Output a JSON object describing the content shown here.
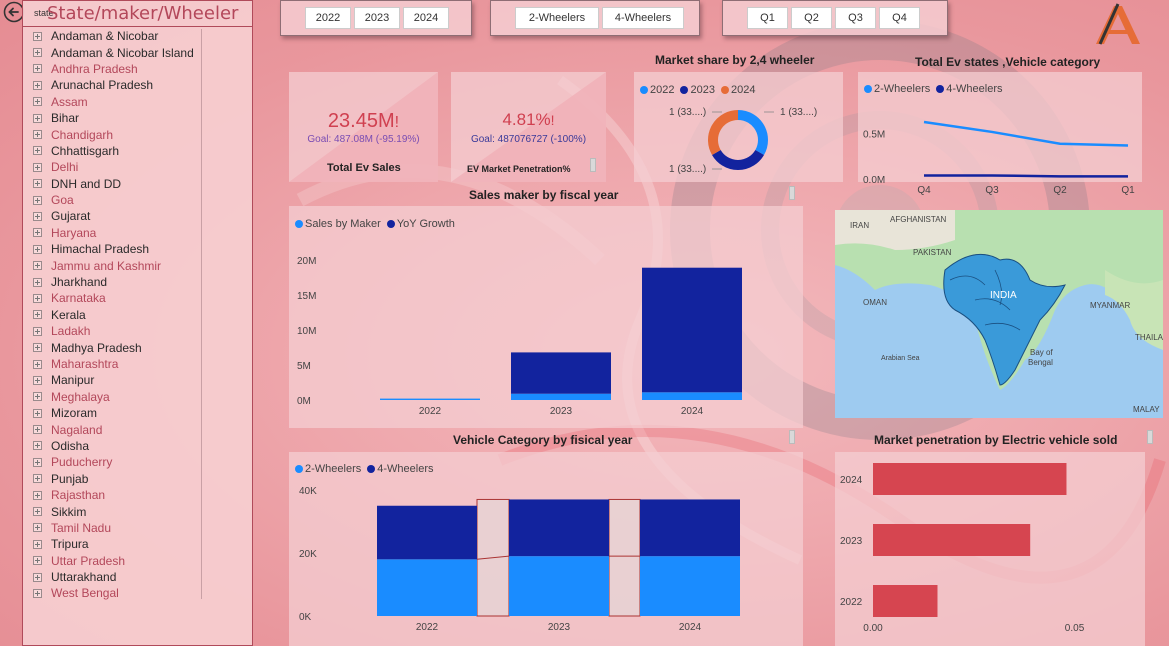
{
  "slicer": {
    "title": "State/maker/Wheeler",
    "small_label": "state",
    "items": [
      "Andaman & Nicobar",
      "Andaman & Nicobar Island",
      "Andhra Pradesh",
      "Arunachal Pradesh",
      "Assam",
      "Bihar",
      "Chandigarh",
      "Chhattisgarh",
      "Delhi",
      "DNH and DD",
      "Goa",
      "Gujarat",
      "Haryana",
      "Himachal Pradesh",
      "Jammu and Kashmir",
      "Jharkhand",
      "Karnataka",
      "Kerala",
      "Ladakh",
      "Madhya Pradesh",
      "Maharashtra",
      "Manipur",
      "Meghalaya",
      "Mizoram",
      "Nagaland",
      "Odisha",
      "Puducherry",
      "Punjab",
      "Rajasthan",
      "Sikkim",
      "Tamil Nadu",
      "Tripura",
      "Uttar Pradesh",
      "Uttarakhand",
      "West Bengal"
    ]
  },
  "year_buttons": [
    "2022",
    "2023",
    "2024"
  ],
  "wheeler_buttons": [
    "2-Wheelers",
    "4-Wheelers"
  ],
  "quarter_buttons": [
    "Q1",
    "Q2",
    "Q3",
    "Q4"
  ],
  "kpi_sales": {
    "value": "23.45M",
    "bang": "!",
    "goal": "Goal: 487.08M (-95.19%)",
    "label": "Total Ev Sales"
  },
  "kpi_penetration": {
    "value": "4.81%",
    "bang": "!",
    "goal": "Goal: 487076727 (-100%)",
    "label": "EV Market Penetration%"
  },
  "colors": {
    "light_blue": "#1a8cff",
    "dark_blue": "#12239e",
    "orange": "#e66c37",
    "red_bar": "#d64550",
    "accent": "#d04050"
  },
  "icons": {
    "logo": "logo-icon",
    "back": "back-arrow-icon"
  },
  "map": {
    "labels": [
      "IRAN",
      "AFGHANISTAN",
      "PAKISTAN",
      "INDIA",
      "OMAN",
      "MYANMAR",
      "THAILA",
      "Arabian Sea",
      "Bay of",
      "Bengal",
      "MALAY"
    ]
  },
  "chart_data": [
    {
      "type": "pie",
      "title": "Market share by 2,4 wheeler",
      "legend": [
        "2022",
        "2023",
        "2024"
      ],
      "slice_labels": [
        "1 (33....)",
        "1 (33....)",
        "1 (33....)"
      ],
      "values": [
        1,
        1,
        1
      ],
      "colors": [
        "#1a8cff",
        "#12239e",
        "#e66c37"
      ],
      "legend_position": "top-left"
    },
    {
      "type": "line",
      "title": "Total Ev states ,Vehicle category",
      "categories": [
        "Q4",
        "Q3",
        "Q2",
        "Q1"
      ],
      "series": [
        {
          "name": "2-Wheelers",
          "values": [
            0.64,
            0.53,
            0.4,
            0.38
          ],
          "color": "#1a8cff"
        },
        {
          "name": "4-Wheelers",
          "values": [
            0.05,
            0.05,
            0.04,
            0.04
          ],
          "color": "#12239e"
        }
      ],
      "ylim": [
        0,
        0.75
      ],
      "y_ticks": [
        "0.0M",
        "0.5M"
      ],
      "legend_position": "top-left"
    },
    {
      "type": "bar",
      "title": "Sales maker by fiscal year",
      "categories": [
        "2022",
        "2023",
        "2024"
      ],
      "series": [
        {
          "name": "Sales by Maker",
          "values": [
            0.2,
            0.9,
            1.1
          ],
          "color": "#1a8cff"
        },
        {
          "name": "YoY Growth",
          "values": [
            0.0,
            5.9,
            17.8
          ],
          "color": "#12239e"
        }
      ],
      "ylim": [
        0,
        22
      ],
      "y_ticks": [
        "0M",
        "5M",
        "10M",
        "15M",
        "20M"
      ],
      "stacked": true,
      "legend_position": "top-left"
    },
    {
      "type": "bar",
      "title": "Vehicle Category by fisical year",
      "categories": [
        "2022",
        "2023",
        "2024"
      ],
      "series": [
        {
          "name": "2-Wheelers",
          "values": [
            18000,
            19000,
            19000
          ],
          "color": "#1a8cff"
        },
        {
          "name": "4-Wheelers",
          "values": [
            17000,
            18000,
            18000
          ],
          "color": "#12239e"
        }
      ],
      "ylim": [
        0,
        40000
      ],
      "y_ticks": [
        "0K",
        "20K",
        "40K"
      ],
      "stacked": true,
      "legend_position": "top-left"
    },
    {
      "type": "bar",
      "orientation": "horizontal",
      "title": "Market penetration by Electric vehicle sold",
      "categories": [
        "2024",
        "2023",
        "2022"
      ],
      "values": [
        0.048,
        0.039,
        0.016
      ],
      "color": "#d64550",
      "xlim": [
        0,
        0.065
      ],
      "x_ticks": [
        "0.00",
        "0.05"
      ]
    }
  ]
}
